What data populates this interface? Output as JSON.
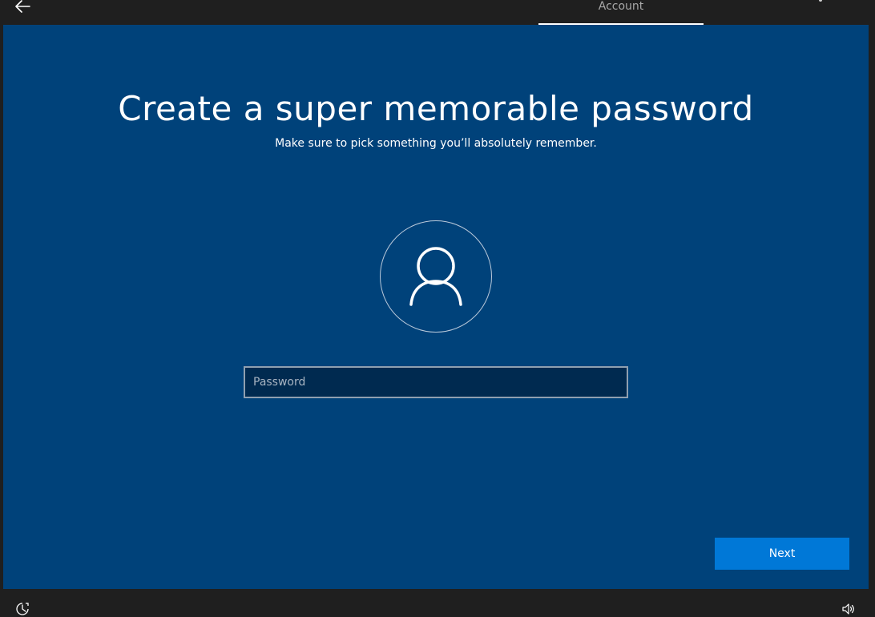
{
  "header": {
    "back_icon": "arrow-left-icon",
    "current_step": "Account"
  },
  "main": {
    "title": "Create a super memorable password",
    "subtitle": "Make sure to pick something you’ll absolutely remember.",
    "avatar_icon": "user-icon",
    "password_field": {
      "placeholder": "Password",
      "value": ""
    },
    "next_label": "Next"
  },
  "footer": {
    "accessibility_icon": "ease-of-access-icon",
    "volume_icon": "volume-icon"
  },
  "colors": {
    "panel_background": "#00427a",
    "chrome_background": "#1f1f1f",
    "accent": "#0078d7",
    "input_background": "#002a50"
  }
}
